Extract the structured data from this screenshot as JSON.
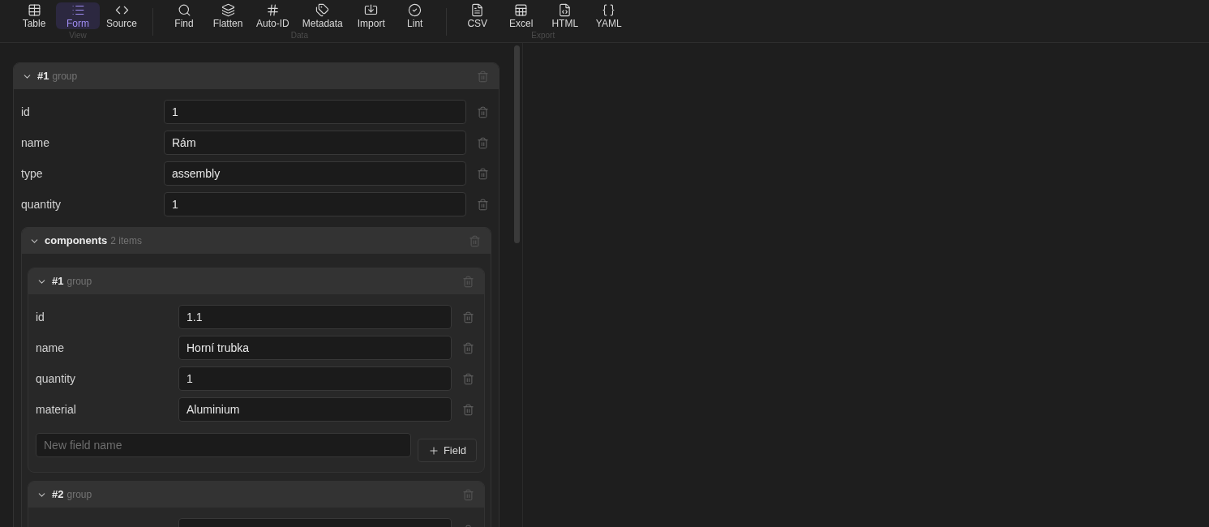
{
  "toolbar": {
    "groups": [
      {
        "label": "View",
        "buttons": [
          {
            "label": "Table",
            "selected": false
          },
          {
            "label": "Form",
            "selected": true
          },
          {
            "label": "Source",
            "selected": false
          }
        ]
      },
      {
        "label": "Data",
        "buttons": [
          {
            "label": "Find"
          },
          {
            "label": "Flatten"
          },
          {
            "label": "Auto-ID"
          },
          {
            "label": "Metadata"
          },
          {
            "label": "Import"
          },
          {
            "label": "Lint"
          }
        ]
      },
      {
        "label": "Export",
        "buttons": [
          {
            "label": "CSV"
          },
          {
            "label": "Excel"
          },
          {
            "label": "HTML"
          },
          {
            "label": "YAML"
          }
        ]
      }
    ]
  },
  "form": {
    "groups": [
      {
        "index": "#1",
        "caption": "group",
        "expanded": true,
        "entries": [
          {
            "kind": "field",
            "label": "id",
            "value": "1"
          },
          {
            "kind": "field",
            "label": "name",
            "value": "Rám"
          },
          {
            "kind": "field",
            "label": "type",
            "value": "assembly"
          },
          {
            "kind": "field",
            "label": "quantity",
            "value": "1"
          },
          {
            "kind": "array",
            "label": "components",
            "count": "2 items",
            "expanded": true,
            "items": [
              {
                "index": "#1",
                "caption": "group",
                "expanded": true,
                "entries": [
                  {
                    "kind": "field",
                    "label": "id",
                    "value": "1.1"
                  },
                  {
                    "kind": "field",
                    "label": "name",
                    "value": "Horní trubka"
                  },
                  {
                    "kind": "field",
                    "label": "quantity",
                    "value": "1"
                  },
                  {
                    "kind": "field",
                    "label": "material",
                    "value": "Aluminium"
                  }
                ],
                "new_field": {
                  "placeholder": "New field name",
                  "button": "Field"
                }
              },
              {
                "index": "#2",
                "caption": "group",
                "expanded": true,
                "entries": [
                  {
                    "kind": "field"
                  }
                ]
              }
            ]
          }
        ]
      }
    ]
  }
}
